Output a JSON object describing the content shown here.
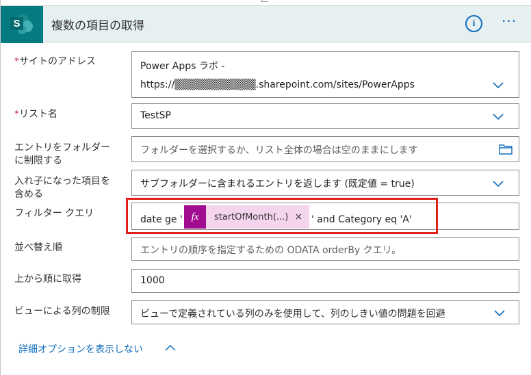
{
  "header": {
    "title": "複数の項目の取得",
    "app_icon_letter": "S",
    "info_icon": "info-icon",
    "more_icon": "more-icon",
    "more_glyph": "···",
    "accent": "#037b80",
    "link_color": "#0f6cbd"
  },
  "fields": {
    "site": {
      "label": "サイトのアドレス",
      "required_mark": "*",
      "line1": "Power Apps ラボ -",
      "line2": "https://▒▒▒▒▒▒▒▒▒▒▒.sharepoint.com/sites/PowerApps"
    },
    "list": {
      "label": "リスト名",
      "required_mark": "*",
      "value": "TestSP"
    },
    "folder": {
      "label_line1": "エントリをフォルダー",
      "label_line2": "に制限する",
      "placeholder": "フォルダーを選択するか、リスト全体の場合は空のままにします"
    },
    "nested": {
      "label_line1": "入れ子になった項目を",
      "label_line2": "含める",
      "value": "サブフォルダーに含まれるエントリを返します (既定値 = true)"
    },
    "filter": {
      "label": "フィルター クエリ",
      "prefix": "date ge '",
      "token_glyph": "fx",
      "token_label": "startOfMonth(...)",
      "token_close": "×",
      "suffix": "' and Category eq 'A'",
      "token_color": "#a10b8f",
      "highlight_color": "#e0201b"
    },
    "order": {
      "label": "並べ替え順",
      "placeholder": "エントリの順序を指定するための ODATA orderBy クエリ。"
    },
    "top": {
      "label": "上から順に取得",
      "value": "1000"
    },
    "view": {
      "label": "ビューによる列の制限",
      "placeholder": "ビューで定義されている列のみを使用して、列のしきい値の問題を回避"
    }
  },
  "advanced": {
    "link_label": "詳細オプションを表示しない"
  }
}
